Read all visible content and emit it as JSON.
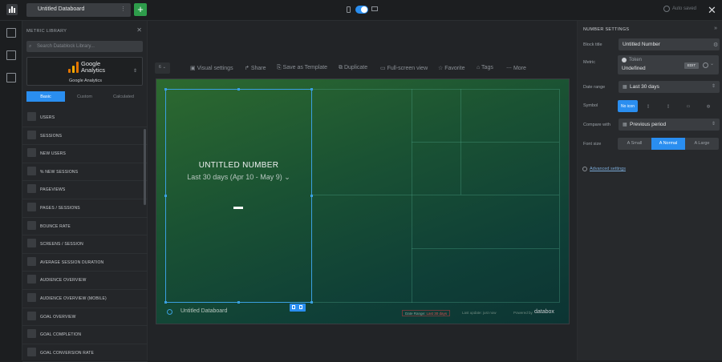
{
  "topbar": {
    "databoard_name": "Untitled Databoard",
    "add_label": "+",
    "autosave_label": "Auto saved",
    "close_label": "✕"
  },
  "library": {
    "title": "METRIC LIBRARY",
    "close_label": "✕",
    "search_placeholder": "Search Datablock Library...",
    "source_brand": "Google Analytics",
    "source_label": "Google Analytics",
    "tabs": [
      "Basic",
      "Custom",
      "Calculated"
    ],
    "metrics": [
      {
        "label": "USERS",
        "icon": "line-chart-icon"
      },
      {
        "label": "SESSIONS",
        "icon": "line-chart-icon"
      },
      {
        "label": "NEW USERS",
        "icon": "line-chart-icon"
      },
      {
        "label": "% NEW SESSIONS",
        "icon": "line-chart-icon"
      },
      {
        "label": "PAGEVIEWS",
        "icon": "line-chart-icon"
      },
      {
        "label": "PAGES / SESSIONS",
        "icon": "line-chart-icon"
      },
      {
        "label": "BOUNCE RATE",
        "icon": "line-chart-icon"
      },
      {
        "label": "SCREENS / SESSION",
        "icon": "line-chart-icon"
      },
      {
        "label": "AVERAGE SESSION DURATION",
        "icon": "line-chart-icon"
      },
      {
        "label": "AUDIENCE OVERVIEW",
        "icon": "table-icon"
      },
      {
        "label": "AUDIENCE OVERVIEW (MOBILE)",
        "icon": "table-icon"
      },
      {
        "label": "GOAL OVERVIEW",
        "icon": "goal-icon"
      },
      {
        "label": "GOAL COMPLETION",
        "icon": "number-icon"
      },
      {
        "label": "GOAL CONVERSION RATE",
        "icon": "number-icon"
      }
    ]
  },
  "toolbar": {
    "back_label": "6 ⌄",
    "items": [
      "Visual settings",
      "Share",
      "Save as Template",
      "Duplicate",
      "Full-screen view",
      "Favorite",
      "Tags",
      "More"
    ]
  },
  "block": {
    "title": "UNTITLED NUMBER",
    "date_label": "Last 30 days (Apr 10 - May 9) ⌄"
  },
  "footer": {
    "databoard_name": "Untitled Databoard",
    "date_prefix": "Date Range:",
    "date_value": "Last 30 days",
    "update_text": "Last update: just now",
    "powered_text": "Powered by",
    "brand": "databox"
  },
  "settings": {
    "title": "NUMBER SETTINGS",
    "collapse_label": "»",
    "block_title_label": "Block title",
    "block_title_value": "Untitled Number",
    "metric_label": "Metric",
    "metric_token": "Token",
    "metric_value": "Undefined",
    "metric_edit": "EDIT",
    "date_range_label": "Date range",
    "date_range_value": "Last 30 days",
    "symbol_label": "Symbol",
    "symbol_options": [
      "No icon",
      "",
      "",
      "",
      ""
    ],
    "compare_label": "Compare with",
    "compare_value": "Previous period",
    "font_size_label": "Font size",
    "font_sizes": [
      "A Small",
      "A Normal",
      "A Large"
    ],
    "advanced_label": "Advanced settings",
    "accent_color": "#2a8ef0"
  }
}
